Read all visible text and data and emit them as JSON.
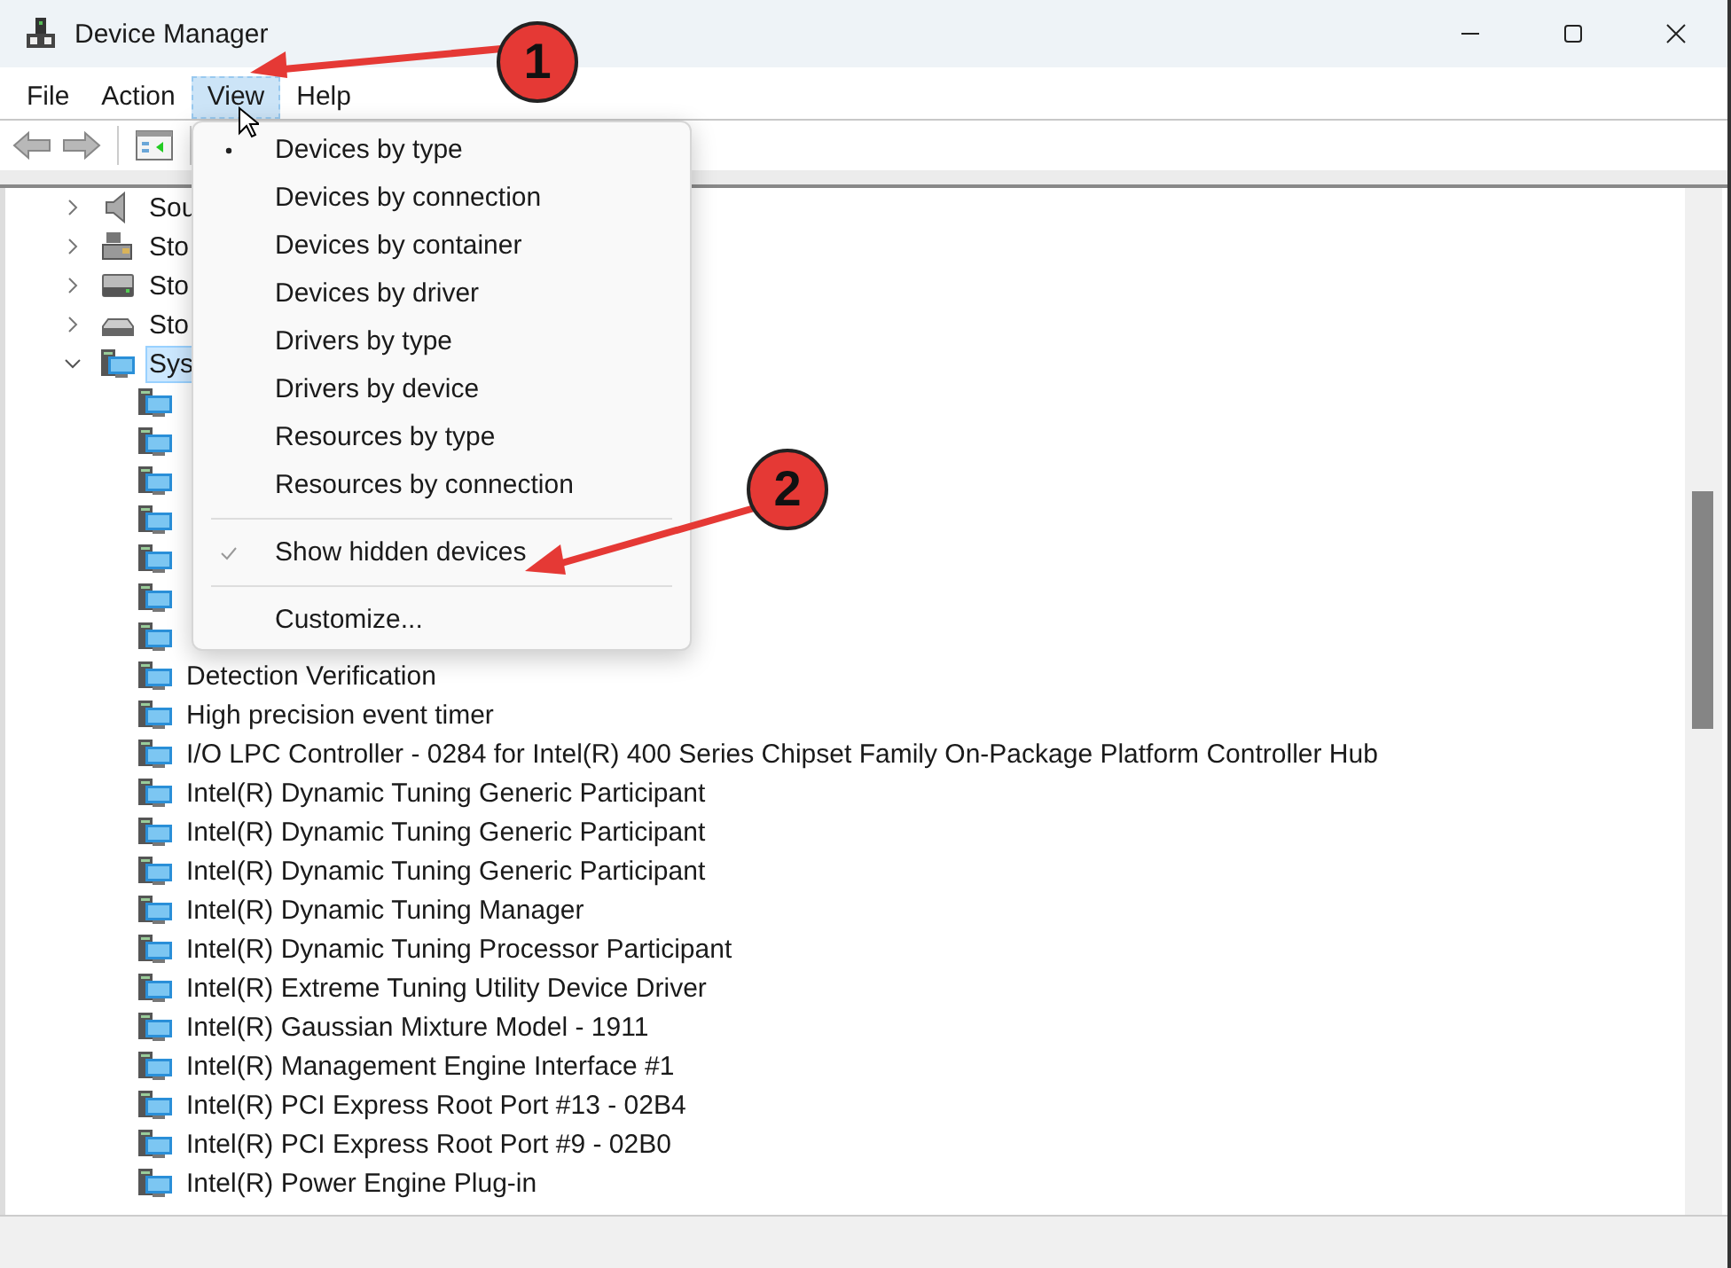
{
  "window": {
    "title": "Device Manager"
  },
  "menu_bar": [
    {
      "label": "File",
      "selected": false
    },
    {
      "label": "Action",
      "selected": false
    },
    {
      "label": "View",
      "selected": true
    },
    {
      "label": "Help",
      "selected": false
    }
  ],
  "view_menu": {
    "groups": [
      [
        {
          "label": "Devices by type",
          "kind": "radio",
          "checked": true
        },
        {
          "label": "Devices by connection",
          "kind": "radio",
          "checked": false
        },
        {
          "label": "Devices by container",
          "kind": "radio",
          "checked": false
        },
        {
          "label": "Devices by driver",
          "kind": "radio",
          "checked": false
        },
        {
          "label": "Drivers by type",
          "kind": "radio",
          "checked": false
        },
        {
          "label": "Drivers by device",
          "kind": "radio",
          "checked": false
        },
        {
          "label": "Resources by type",
          "kind": "radio",
          "checked": false
        },
        {
          "label": "Resources by connection",
          "kind": "radio",
          "checked": false
        }
      ],
      [
        {
          "label": "Show hidden devices",
          "kind": "check",
          "checked": true
        }
      ],
      [
        {
          "label": "Customize...",
          "kind": "plain"
        }
      ]
    ]
  },
  "tree": [
    {
      "label": "Sou",
      "kind": "speaker",
      "expanded": false,
      "selected": false
    },
    {
      "label": "Sto",
      "kind": "storage",
      "expanded": false,
      "selected": false
    },
    {
      "label": "Sto",
      "kind": "disk",
      "expanded": false,
      "selected": false
    },
    {
      "label": "Sto",
      "kind": "drive",
      "expanded": false,
      "selected": false
    },
    {
      "label": "Sys",
      "kind": "system",
      "expanded": true,
      "selected": true,
      "children": [
        {
          "selected": false
        },
        {
          "selected": false
        },
        {
          "selected": false
        },
        {
          "selected": false
        },
        {
          "selected": false
        },
        {
          "selected": false
        },
        {
          "selected": false
        },
        {
          "label": "Detection Verification",
          "selected": false
        },
        {
          "label": "High precision event timer",
          "selected": false
        },
        {
          "label": "I/O LPC Controller - 0284 for Intel(R) 400 Series Chipset Family On-Package Platform Controller Hub",
          "selected": false
        },
        {
          "label": "Intel(R) Dynamic Tuning Generic Participant",
          "selected": false
        },
        {
          "label": "Intel(R) Dynamic Tuning Generic Participant",
          "selected": false
        },
        {
          "label": "Intel(R) Dynamic Tuning Generic Participant",
          "selected": false
        },
        {
          "label": "Intel(R) Dynamic Tuning Manager",
          "selected": false
        },
        {
          "label": "Intel(R) Dynamic Tuning Processor Participant",
          "selected": false
        },
        {
          "label": "Intel(R) Extreme Tuning Utility Device Driver",
          "selected": false
        },
        {
          "label": "Intel(R) Gaussian Mixture Model - 1911",
          "selected": false
        },
        {
          "label": "Intel(R) Management Engine Interface #1",
          "selected": false
        },
        {
          "label": "Intel(R) PCI Express Root Port #13 - 02B4",
          "selected": false
        },
        {
          "label": "Intel(R) PCI Express Root Port #9 - 02B0",
          "selected": false
        },
        {
          "label": "Intel(R) Power Engine Plug-in",
          "selected": false
        }
      ]
    }
  ],
  "annotations": [
    {
      "number": "1"
    },
    {
      "number": "2"
    }
  ]
}
